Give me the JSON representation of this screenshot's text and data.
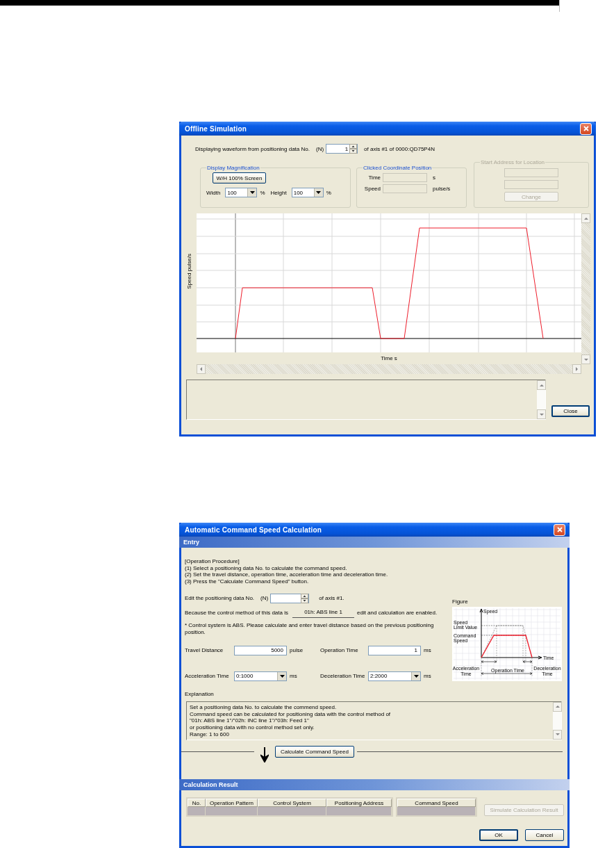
{
  "offline_simulation": {
    "title": "Offline Simulation",
    "data_no": {
      "label": "Displaying waveform from positioning data No.",
      "mnemonic": "(N)",
      "value": "1",
      "suffix": "of axis #1 of 0000:QD75P4N"
    },
    "display_magnification": {
      "title": "Display Magnification",
      "button": "W/H 100% Screen",
      "width_label": "Width",
      "width_value": "100",
      "width_unit": "%",
      "height_label": "Height",
      "height_value": "100",
      "height_unit": "%"
    },
    "clicked_coordinate": {
      "title": "Clicked Coordinate Position",
      "time_label": "Time",
      "time_unit": "s",
      "speed_label": "Speed",
      "speed_unit": "pulse/s"
    },
    "start_address": {
      "title": "Start Address for Location",
      "button": "Change",
      "disabled": true
    },
    "graph": {
      "ylabel": "Speed pulse/s",
      "xlabel": "Time s"
    },
    "close_button": "Close"
  },
  "command_speed_calculation": {
    "title": "Automatic Command Speed Calculation",
    "entry_header": "Entry",
    "procedure": [
      "[Operation Procedure]",
      "(1) Select a positioning data No. to calculate the command speed.",
      "(2) Set the travel distance, operation time, acceleration time and deceleration time.",
      "(3) Press the \"Calculate Command Speed\" button."
    ],
    "data_no": {
      "label": "Edit the positioning data No.",
      "mnemonic": "(N)",
      "suffix": "of axis #1."
    },
    "control_method": {
      "before": "Because the control method of this data is",
      "value": "01h: ABS line 1",
      "after": "edit and calculation are enabled."
    },
    "note": "* Control system is ABS. Please calculate and enter travel distance based on the previous positioning position.",
    "fields": [
      {
        "kind": "text",
        "label": "Travel Distance",
        "value": "5000",
        "unit": "pulse"
      },
      {
        "kind": "text",
        "label": "Operation Time",
        "value": "1",
        "unit": "ms"
      },
      {
        "kind": "combo",
        "label": "Acceleration Time",
        "value": "0:1000",
        "unit": "ms"
      },
      {
        "kind": "combo",
        "label": "Deceleration Time",
        "value": "2:2000",
        "unit": "ms"
      }
    ],
    "figure": {
      "title": "Figure",
      "y_axis": "Speed",
      "x_axis": "Time",
      "limit_label": [
        "Speed",
        "Limit Value"
      ],
      "command_label": [
        "Command",
        "Speed"
      ],
      "acceleration_label": [
        "Acceleration",
        "Time"
      ],
      "operation_label": "Operation Time",
      "deceleration_label": [
        "Deceleration",
        "Time"
      ]
    },
    "explanation": {
      "label": "Explanation",
      "lines": [
        "Set a positioning data No. to calculate the commend speed.",
        "Command speed can be calculated for positioning data with the control method of",
        "\"01h: ABS line 1\"/\"02h: INC line 1\"/\"03h: Feed 1\"",
        "or positioning data with no control method set only.",
        "Range: 1 to 600"
      ]
    },
    "calculate_button": "Calculate Command Speed",
    "result_header": "Calculation Result",
    "result_columns": [
      "No.",
      "Operation Pattern",
      "Control System",
      "Positioning Address"
    ],
    "speed_column": "Command Speed",
    "simulate_button": {
      "label": "Simulate Calculation Result",
      "disabled": true
    },
    "ok_button": "OK",
    "cancel_button": "Cancel"
  }
}
